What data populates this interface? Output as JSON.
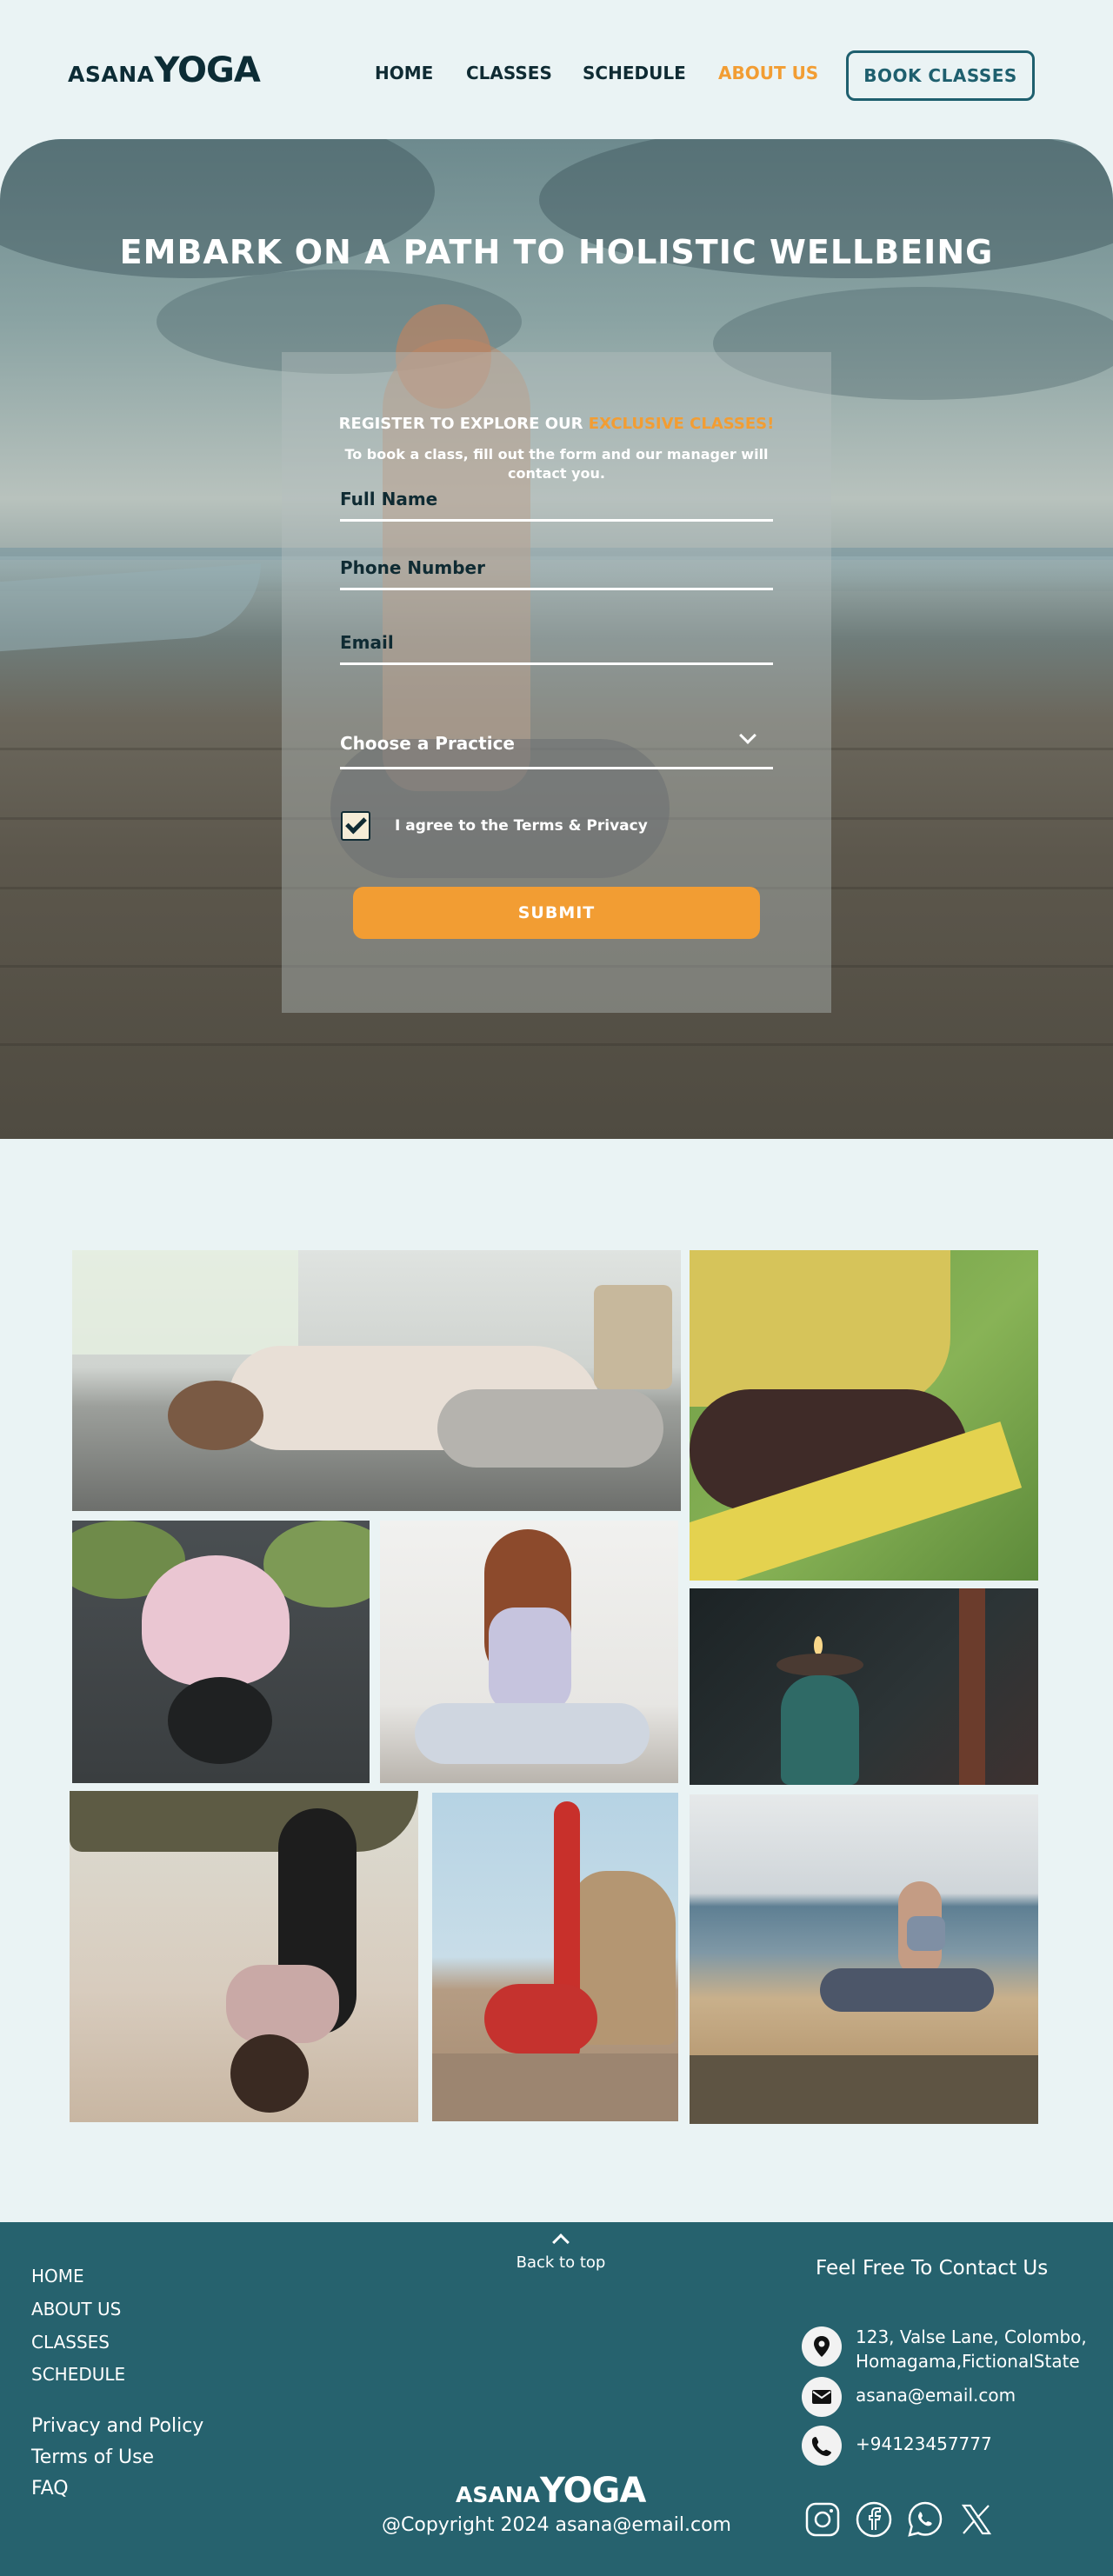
{
  "brand": {
    "small": "ASANA",
    "big": "YOGA"
  },
  "nav": {
    "home": "HOME",
    "classes": "CLASSES",
    "schedule": "SCHEDULE",
    "about": "ABOUT US",
    "book": "BOOK  CLASSES"
  },
  "hero": {
    "title": "EMBARK ON A PATH TO HOLISTIC WELLBEING"
  },
  "form": {
    "heading_prefix": "REGISTER TO EXPLORE OUR ",
    "heading_accent": "EXCLUSIVE CLASSES!",
    "subtitle": "To book a class, fill out the form and our manager will contact you.",
    "full_name_placeholder": "Full Name",
    "phone_placeholder": "Phone Number",
    "email_placeholder": "Email",
    "practice_select": "Choose a Practice",
    "agree_label": "I agree to the Terms & Privacy",
    "agree_checked": true,
    "submit": "SUBMIT"
  },
  "gallery": {
    "images": [
      "woman-reclining-pose",
      "seated-meditation-hands",
      "lotus-flower",
      "woman-meditating",
      "candle-lamp",
      "beach-forward-bend",
      "rock-leg-stretch",
      "beach-lunge-pose"
    ]
  },
  "footer": {
    "links": [
      "HOME",
      "ABOUT US",
      "CLASSES",
      "SCHEDULE"
    ],
    "legal": [
      "Privacy and Policy",
      "Terms of Use",
      "FAQ"
    ],
    "back_to_top": "Back to top",
    "copyright": "@Copyright  2024 asana@email.com",
    "contact_title": "Feel Free To Contact Us",
    "address_line1": "123, Valse Lane, Colombo,",
    "address_line2": "Homagama,FictionalState",
    "email": "asana@email.com",
    "phone": "+94123457777",
    "social_icons": [
      "instagram-icon",
      "facebook-icon",
      "whatsapp-icon",
      "x-icon"
    ]
  },
  "colors": {
    "accent": "#f29d33",
    "teal": "#26626e",
    "background": "#eaf3f4",
    "dark": "#0f2b33"
  }
}
